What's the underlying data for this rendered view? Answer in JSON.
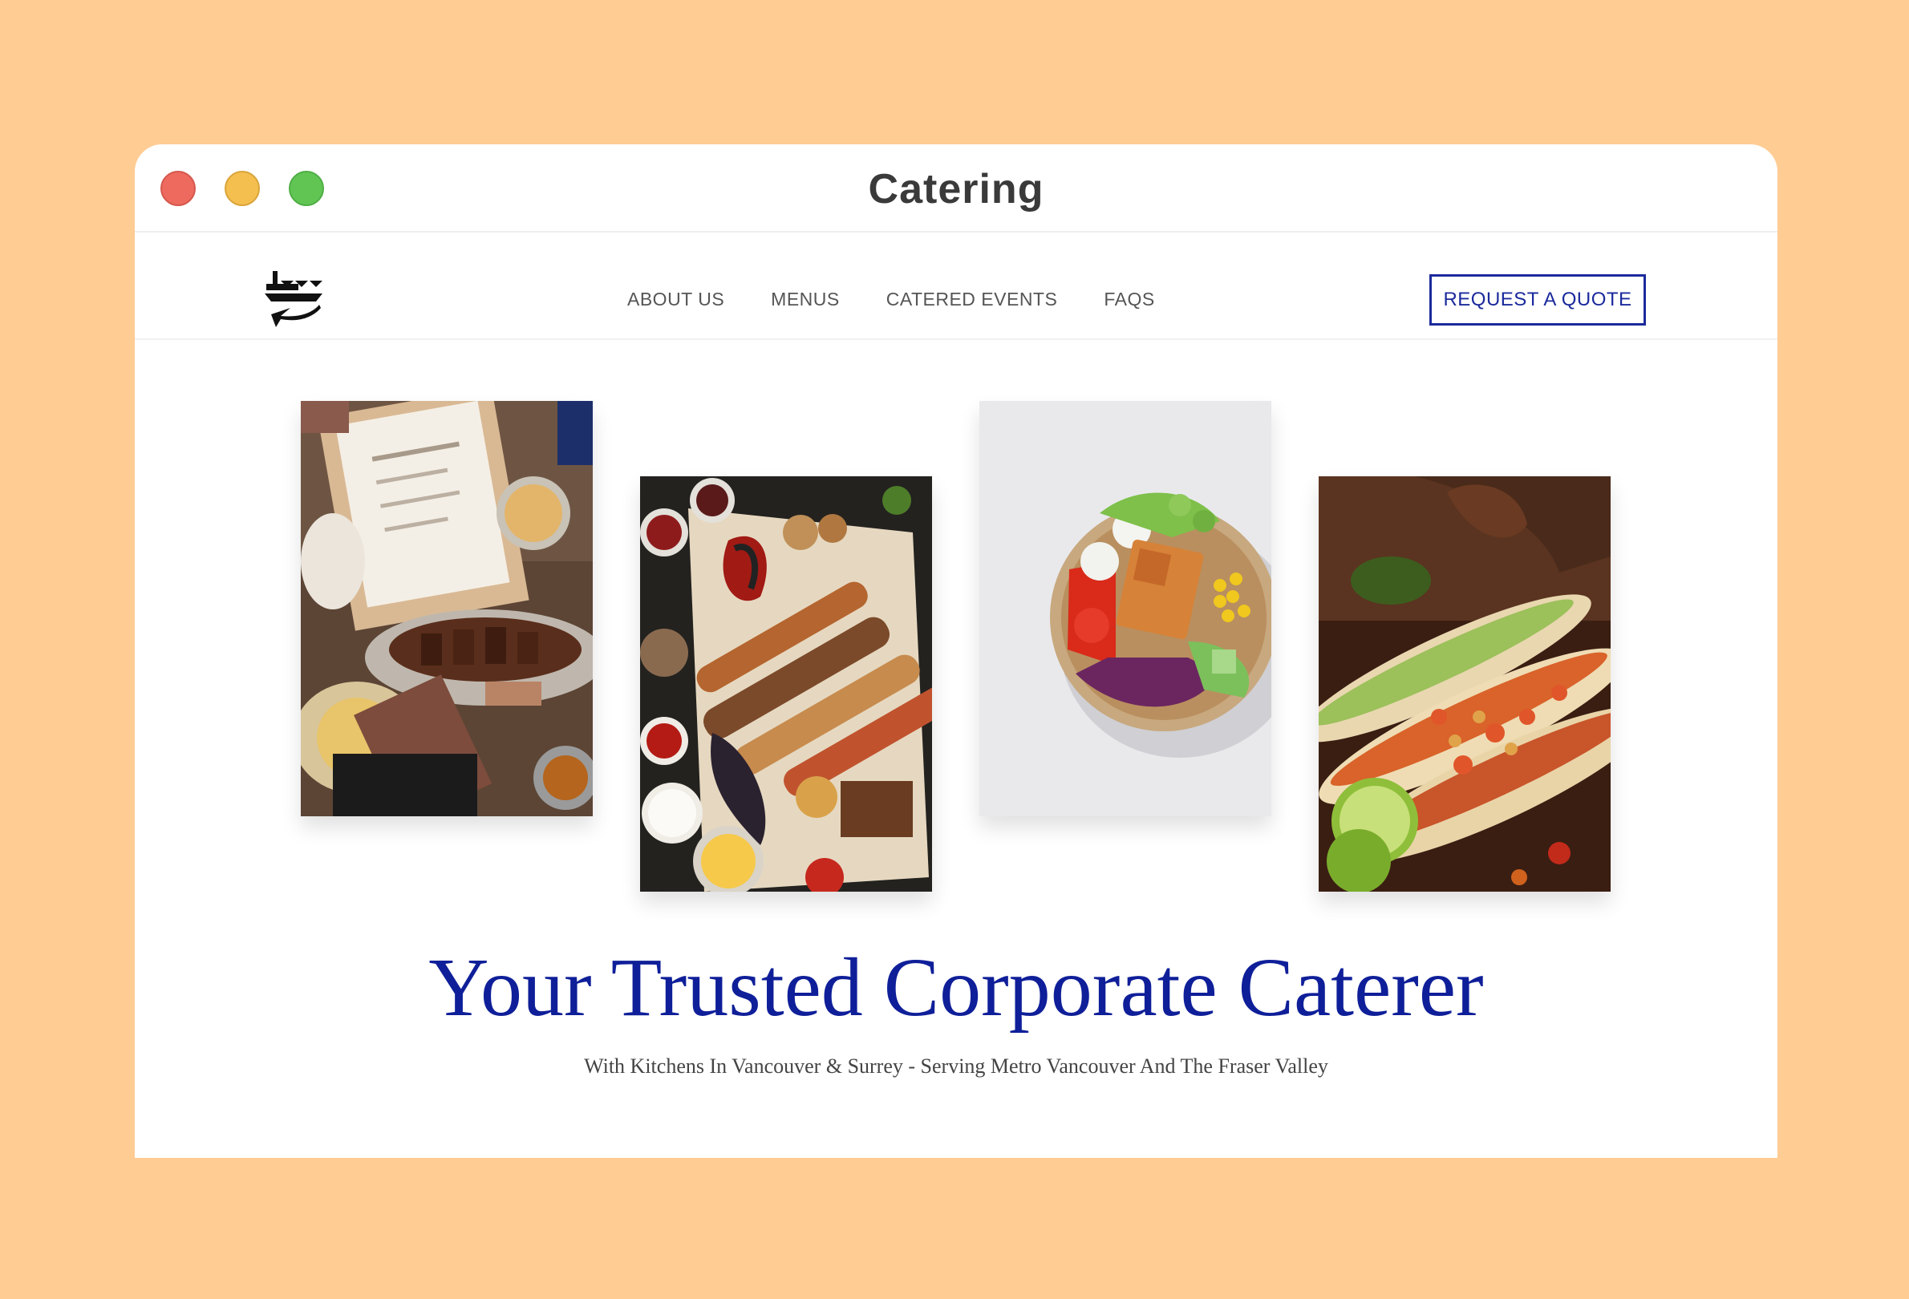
{
  "window": {
    "title": "Catering"
  },
  "nav": {
    "links": [
      "ABOUT US",
      "MENUS",
      "CATERED EVENTS",
      "FAQS"
    ],
    "cta": "REQUEST A QUOTE"
  },
  "gallery": [
    {
      "name": "game-day-snacks-photo"
    },
    {
      "name": "grilled-skewers-photo"
    },
    {
      "name": "salad-bowl-photo"
    },
    {
      "name": "tacos-photo"
    }
  ],
  "hero": {
    "title": "Your Trusted Corporate Caterer",
    "subtitle": "With Kitchens In Vancouver & Surrey - Serving Metro Vancouver And The Fraser Valley"
  },
  "colors": {
    "background": "#ffcc93",
    "brand_blue": "#0f1f99",
    "close": "#ee6a5e",
    "minimize": "#f5bf4f",
    "maximize": "#61c554"
  }
}
